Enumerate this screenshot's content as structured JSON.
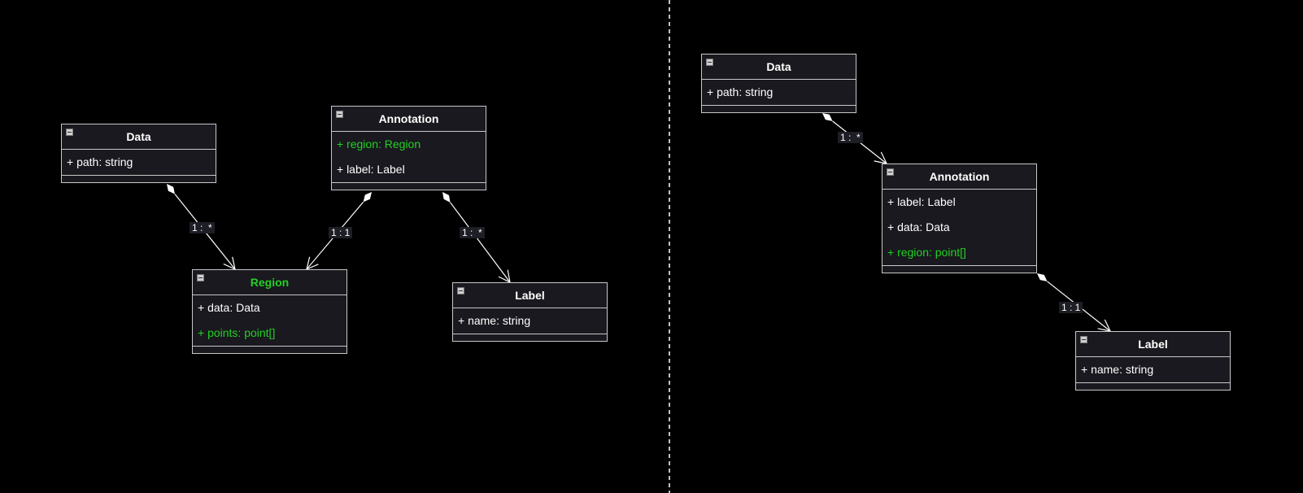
{
  "left_diagram": {
    "data_class": {
      "title": "Data",
      "attributes": [
        {
          "text": "+ path: string",
          "highlight": false
        }
      ]
    },
    "annotation_class": {
      "title": "Annotation",
      "attributes": [
        {
          "text": "+ region: Region",
          "highlight": true
        },
        {
          "text": "+ label: Label",
          "highlight": false
        }
      ]
    },
    "region_class": {
      "title": "Region",
      "title_highlight": true,
      "attributes": [
        {
          "text": "+ data: Data",
          "highlight": false
        },
        {
          "text": "+ points: point[]",
          "highlight": true
        }
      ]
    },
    "label_class": {
      "title": "Label",
      "attributes": [
        {
          "text": "+ name: string",
          "highlight": false
        }
      ]
    },
    "multiplicities": {
      "data_region": "1 :  *",
      "annotation_region": "1 : 1",
      "annotation_label": "1 :  *"
    }
  },
  "right_diagram": {
    "data_class": {
      "title": "Data",
      "attributes": [
        {
          "text": "+ path: string",
          "highlight": false
        }
      ]
    },
    "annotation_class": {
      "title": "Annotation",
      "attributes": [
        {
          "text": "+ label: Label",
          "highlight": false
        },
        {
          "text": "+ data: Data",
          "highlight": false
        },
        {
          "text": "+ region: point[]",
          "highlight": true
        }
      ]
    },
    "label_class": {
      "title": "Label",
      "attributes": [
        {
          "text": "+ name: string",
          "highlight": false
        }
      ]
    },
    "multiplicities": {
      "data_annotation": "1 :  *",
      "annotation_label": "1 : 1"
    }
  },
  "colors": {
    "background": "#000000",
    "box_fill": "#19191f",
    "highlight": "#22d022",
    "line": "#ffffff"
  }
}
